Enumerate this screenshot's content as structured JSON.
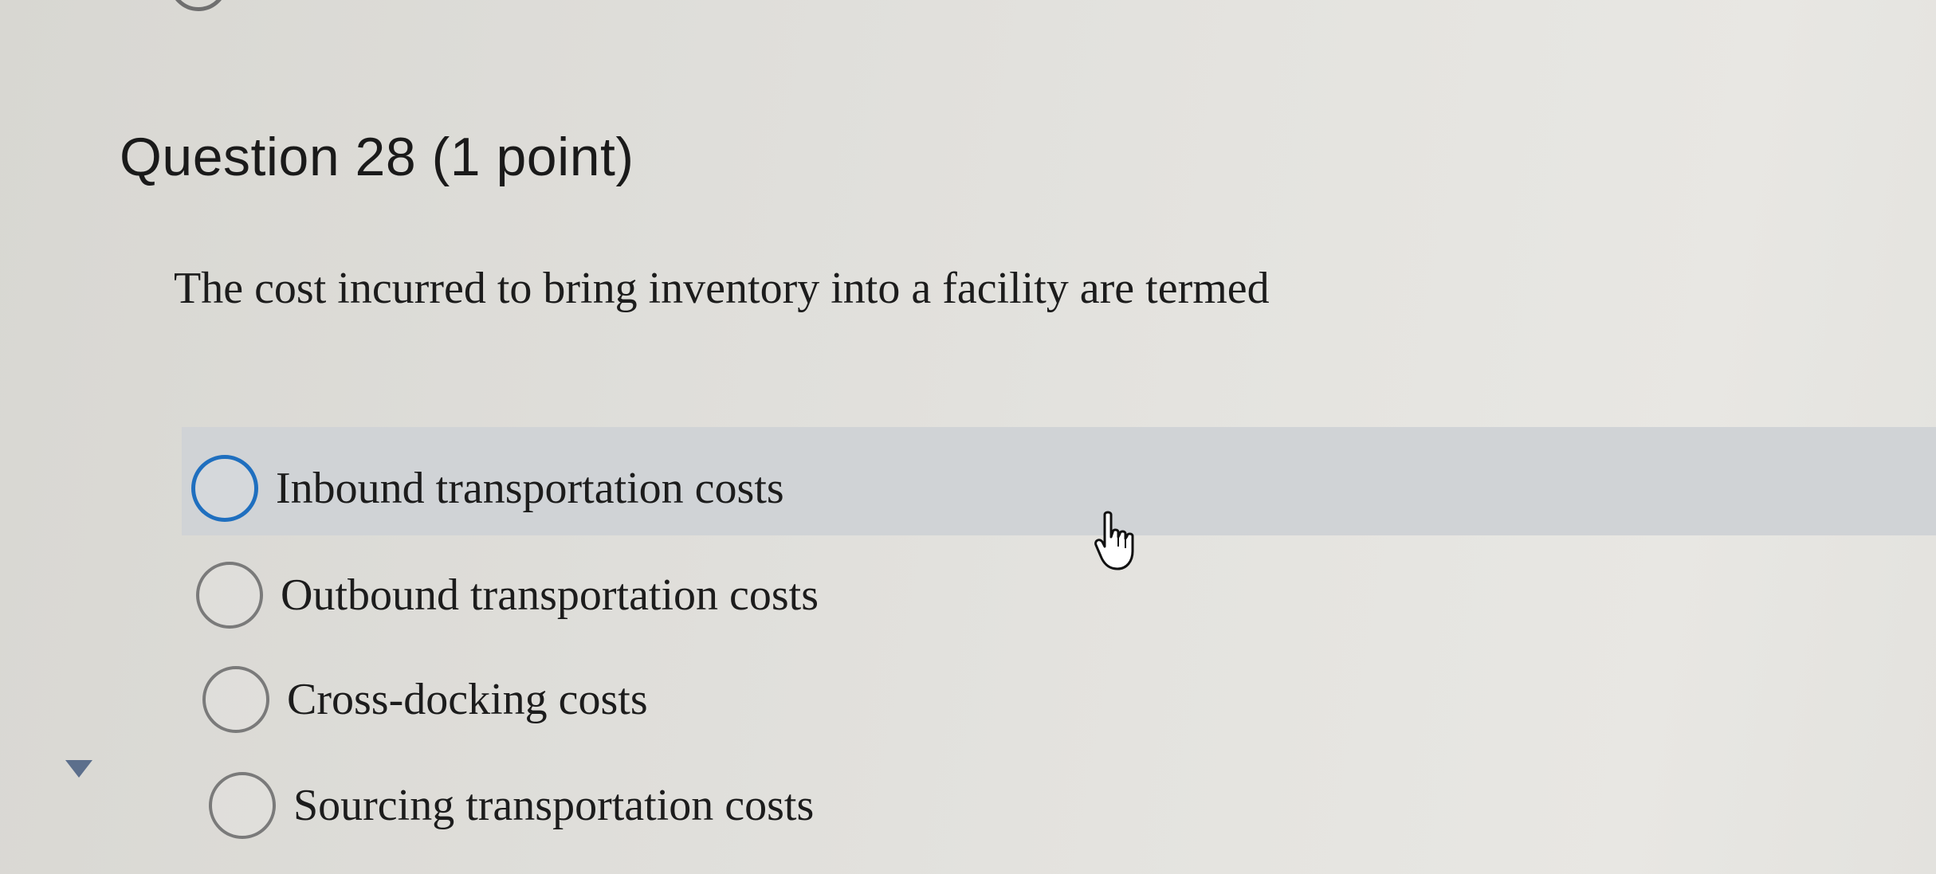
{
  "question": {
    "title": "Question 28 (1 point)",
    "prompt": "The cost incurred to bring inventory into a facility are termed"
  },
  "options": [
    {
      "label": "Inbound transportation costs",
      "selected": false,
      "focused": true
    },
    {
      "label": "Outbound transportation costs",
      "selected": false,
      "focused": false
    },
    {
      "label": "Cross-docking costs",
      "selected": false,
      "focused": false
    },
    {
      "label": "Sourcing transportation costs",
      "selected": false,
      "focused": false
    }
  ],
  "colors": {
    "focus_ring": "#1f6fbf",
    "highlight_row": "#d0d3d6",
    "radio_border": "#7a7a7a"
  },
  "icons": {
    "cursor": "hand-pointer-icon",
    "collapse": "triangle-down-icon"
  }
}
